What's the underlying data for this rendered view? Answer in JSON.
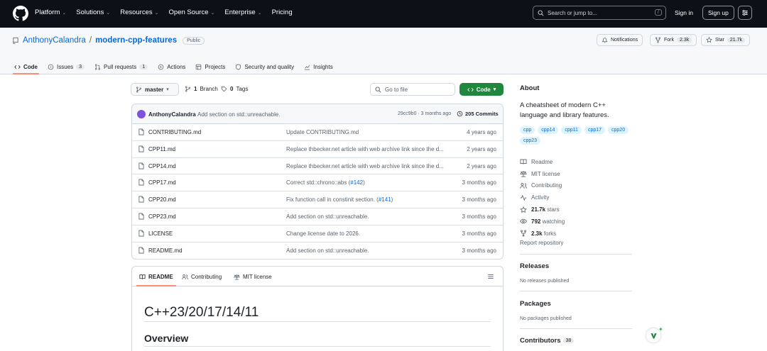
{
  "nav": {
    "items": [
      "Platform",
      "Solutions",
      "Resources",
      "Open Source",
      "Enterprise",
      "Pricing"
    ],
    "chevrons": [
      true,
      true,
      true,
      true,
      true,
      false
    ],
    "search_placeholder": "Search or jump to...",
    "search_key": "/",
    "sign_in": "Sign in",
    "sign_up": "Sign up"
  },
  "repo": {
    "owner": "AnthonyCalandra",
    "separator": "/",
    "name": "modern-cpp-features",
    "visibility": "Public",
    "notifications": "Notifications",
    "fork_label": "Fork",
    "fork_count": "2.3k",
    "star_label": "Star",
    "star_count": "21.7k"
  },
  "tabs": [
    {
      "label": "Code",
      "count": ""
    },
    {
      "label": "Issues",
      "count": "3"
    },
    {
      "label": "Pull requests",
      "count": "1"
    },
    {
      "label": "Actions",
      "count": ""
    },
    {
      "label": "Projects",
      "count": ""
    },
    {
      "label": "Security and quality",
      "count": ""
    },
    {
      "label": "Insights",
      "count": ""
    }
  ],
  "toolbar": {
    "branch": "master",
    "branches_count": "1",
    "branches_label": "Branch",
    "tags_count": "0",
    "tags_label": "Tags",
    "goto_file": "Go to file",
    "code_button": "Code"
  },
  "commit": {
    "author": "AnthonyCalandra",
    "message": "Add section on std::unreachable.",
    "meta": "29cc9b0 · 3 months ago",
    "count": "205 Commits"
  },
  "files": [
    {
      "name": "CONTRIBUTING.md",
      "message": "Update CONTRIBUTING.md",
      "link": "",
      "age": "4 years ago"
    },
    {
      "name": "CPP11.md",
      "message": "Replace thbecker.net article with web archive link since the d...",
      "link": "",
      "age": "2 years ago"
    },
    {
      "name": "CPP14.md",
      "message": "Replace thbecker.net article with web archive link since the d...",
      "link": "",
      "age": "2 years ago"
    },
    {
      "name": "CPP17.md",
      "message": "Correct std::chrono::abs (",
      "link": "#142",
      "suffix": ")",
      "age": "3 months ago"
    },
    {
      "name": "CPP20.md",
      "message": "Fix function call in constinit section. (",
      "link": "#141",
      "suffix": ")",
      "age": "3 months ago"
    },
    {
      "name": "CPP23.md",
      "message": "Add section on std::unreachable.",
      "link": "",
      "age": "3 months ago"
    },
    {
      "name": "LICENSE",
      "message": "Change license date to 2026.",
      "link": "",
      "age": "3 months ago"
    },
    {
      "name": "README.md",
      "message": "Add section on std::unreachable.",
      "link": "",
      "age": "3 months ago"
    }
  ],
  "readme": {
    "tabs": [
      "README",
      "Contributing",
      "MIT license"
    ],
    "heading": "C++23/20/17/14/11",
    "subheading": "Overview"
  },
  "about": {
    "title": "About",
    "description": "A cheatsheet of modern C++ language and library features.",
    "topics": [
      "cpp",
      "cpp14",
      "cpp11",
      "cpp17",
      "cpp20",
      "cpp23"
    ],
    "links": [
      {
        "icon": "book-icon",
        "value": "",
        "label": "Readme"
      },
      {
        "icon": "law-icon",
        "value": "",
        "label": "MIT license"
      },
      {
        "icon": "people-icon",
        "value": "",
        "label": "Contributing"
      },
      {
        "icon": "pulse-icon",
        "value": "",
        "label": "Activity"
      },
      {
        "icon": "star-icon",
        "value": "21.7k",
        "label": "stars"
      },
      {
        "icon": "eye-icon",
        "value": "792",
        "label": "watching"
      },
      {
        "icon": "fork-icon",
        "value": "2.3k",
        "label": "forks"
      }
    ],
    "report": "Report repository"
  },
  "releases": {
    "title": "Releases",
    "subtitle": "No releases published"
  },
  "packages": {
    "title": "Packages",
    "subtitle": "No packages published"
  },
  "contributors": {
    "title": "Contributors",
    "count": "38"
  },
  "colors": {
    "accent": "#0969da",
    "green": "#1f883d",
    "tab_underline": "#fd8c73",
    "topbar": "#0d1117"
  }
}
